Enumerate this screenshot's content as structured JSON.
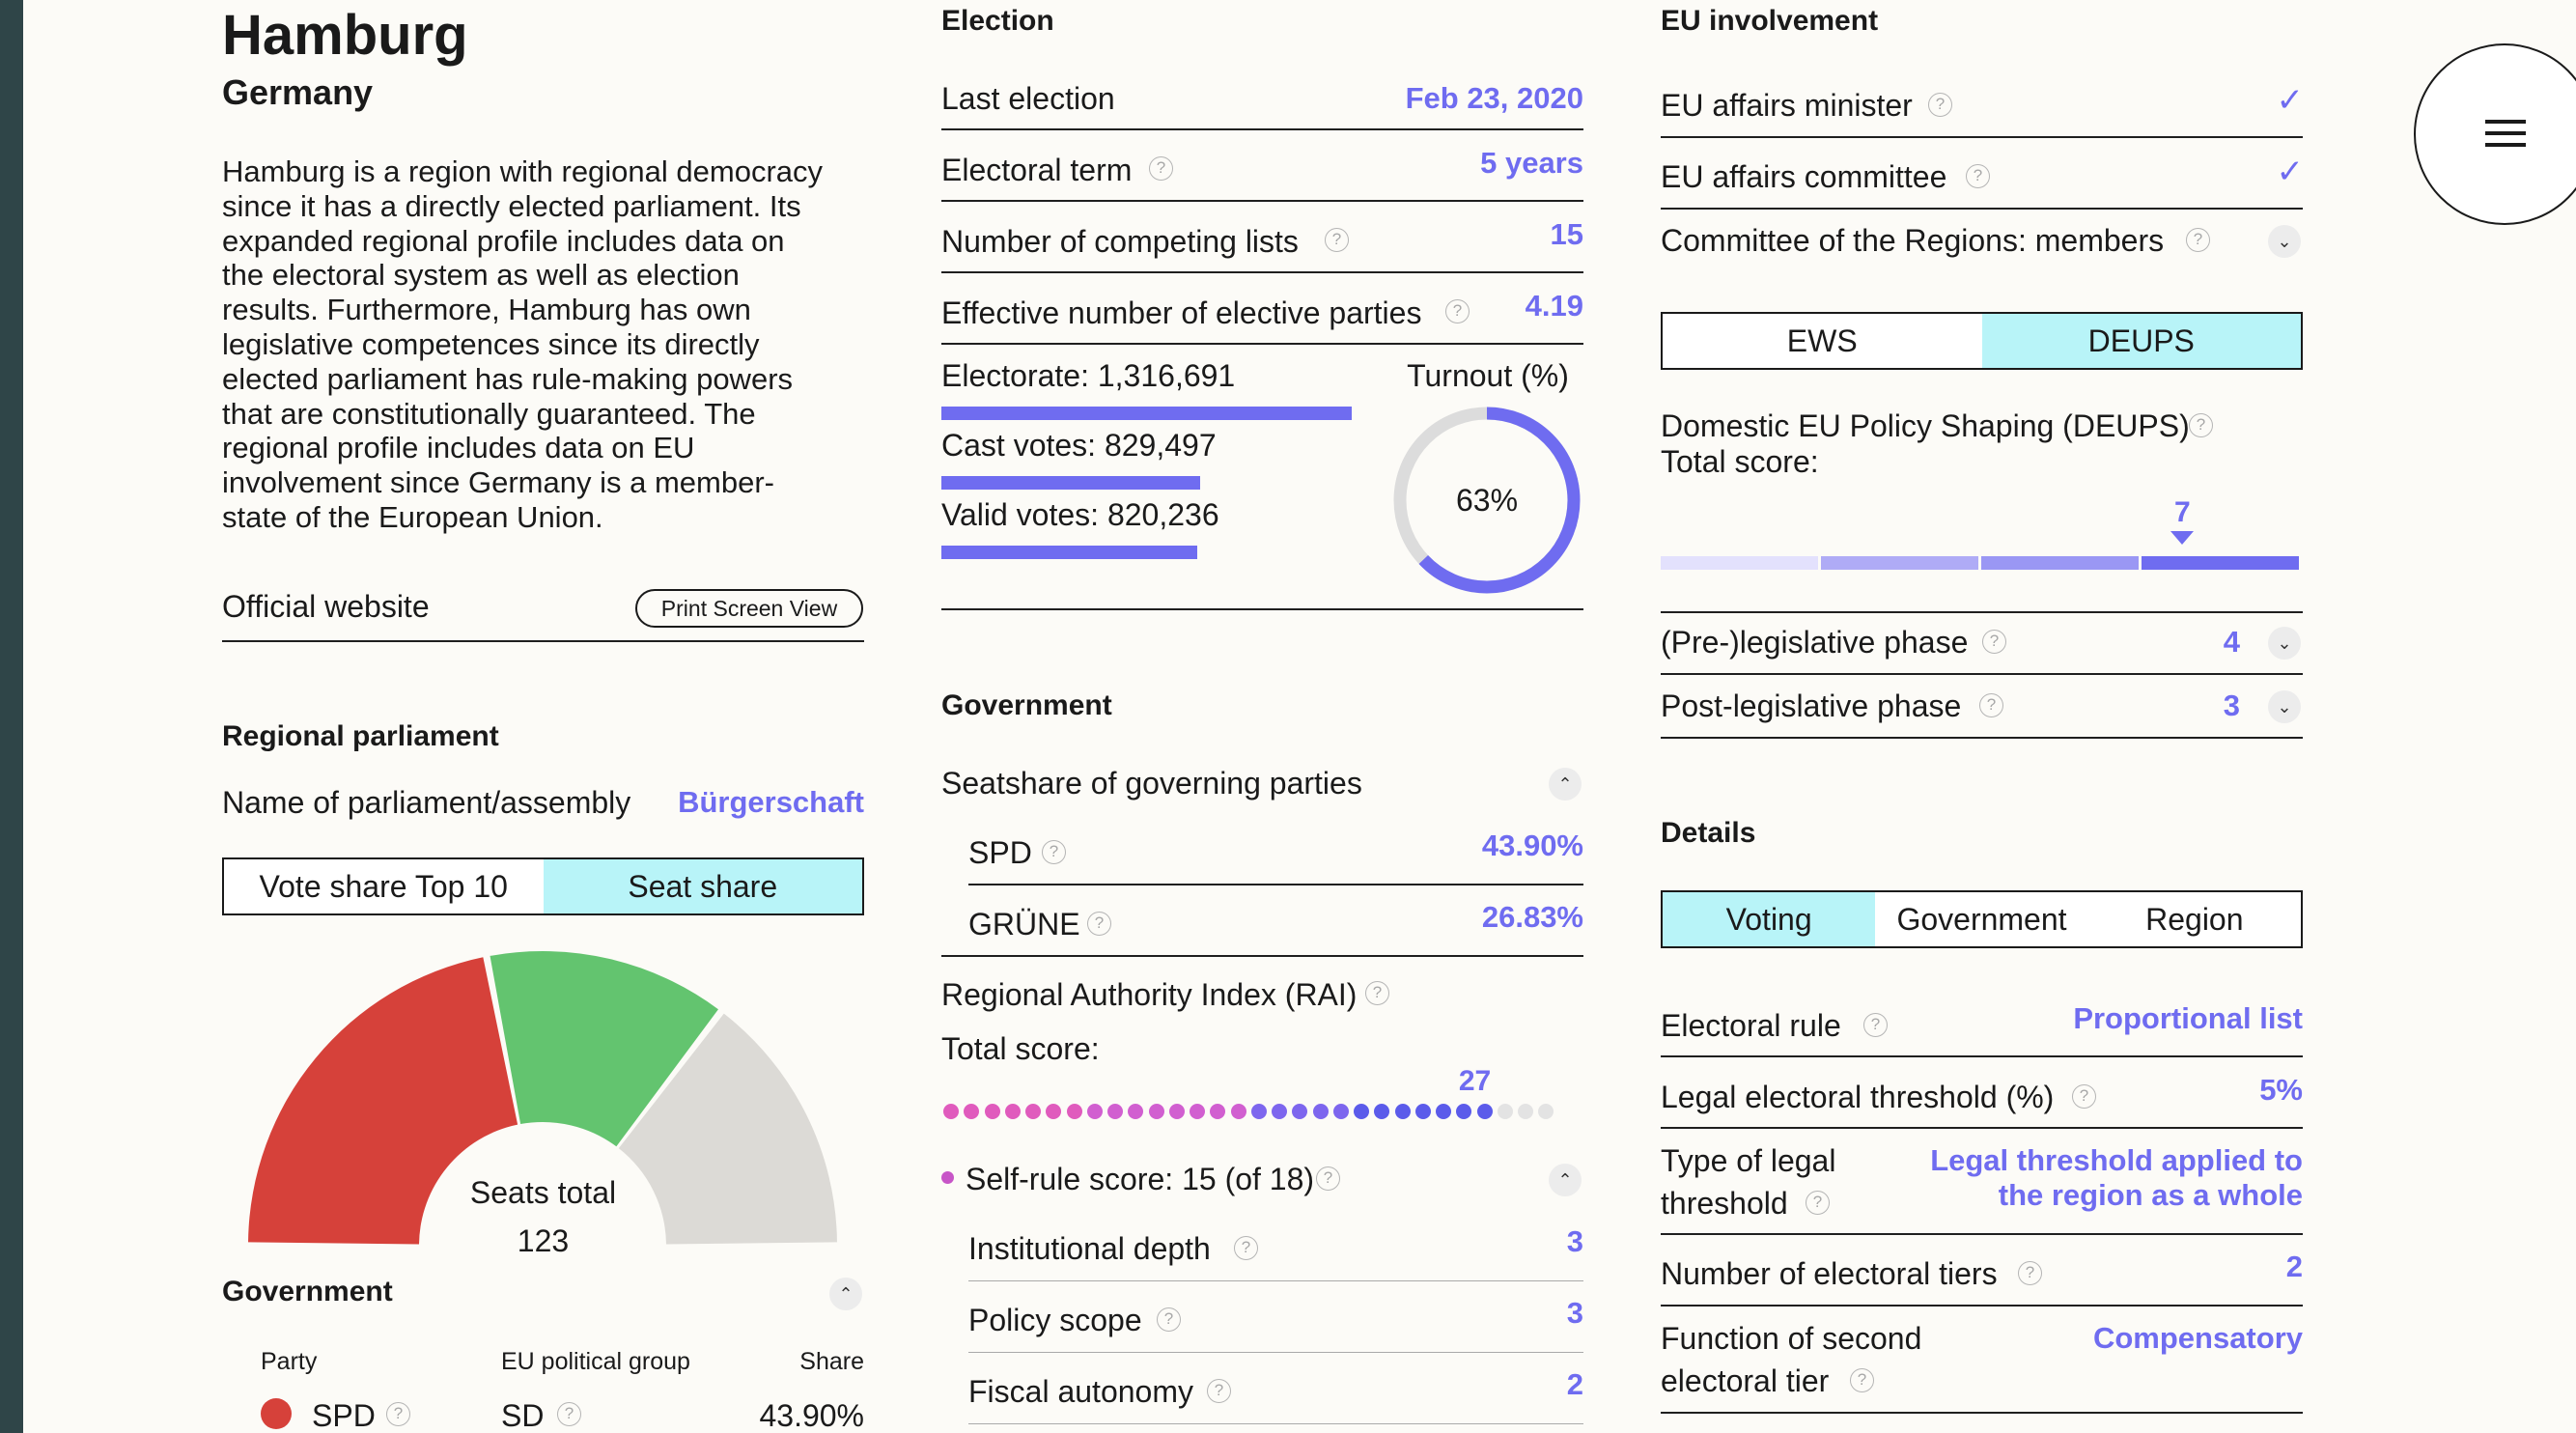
{
  "region": {
    "name": "Hamburg",
    "country": "Germany",
    "description": [
      "Hamburg is a region with regional democracy",
      "since it has a directly elected parliament. Its",
      "expanded regional profile includes data on",
      "the electoral system as well as election",
      "results. Furthermore, Hamburg has own",
      "legislative competences since its directly",
      "elected parliament has rule-making powers",
      "that are constitutionally guaranteed. The",
      "regional profile includes data on EU",
      "involvement since Germany is a member-",
      "state of the European Union."
    ],
    "official_website": "Official website",
    "print_button": "Print Screen View"
  },
  "regional_parliament": {
    "heading": "Regional parliament",
    "name_label": "Name of parliament/assembly",
    "name_value": "Bürgerschaft",
    "tabs": [
      "Vote share Top 10",
      "Seat share"
    ],
    "active_tab": 1,
    "seats_label": "Seats total",
    "seats_total": "123",
    "seat_shares": [
      {
        "party": "SPD",
        "share": 43.9,
        "color": "#d6413a"
      },
      {
        "party": "GRÜNE",
        "share": 26.83,
        "color": "#63c46f"
      },
      {
        "party": "Other",
        "share": 29.27,
        "color": "#dcdad6"
      }
    ]
  },
  "government_left": {
    "heading": "Government",
    "col_party": "Party",
    "col_group": "EU political group",
    "col_share": "Share",
    "rows": [
      {
        "party": "SPD",
        "group": "SD",
        "share": "43.90%",
        "color": "#d6413a"
      }
    ]
  },
  "election": {
    "heading": "Election",
    "last_election_label": "Last election",
    "last_election": "Feb 23, 2020",
    "term_label": "Electoral term",
    "term": "5 years",
    "lists_label": "Number of competing lists",
    "lists": "15",
    "enp_label": "Effective number of elective parties",
    "enp": "4.19",
    "electorate_label": "Electorate: 1,316,691",
    "cast_label": "Cast votes: 829,497",
    "valid_label": "Valid votes: 820,236",
    "electorate": 1316691,
    "cast": 829497,
    "valid": 820236,
    "turnout_label": "Turnout (%)",
    "turnout": 63,
    "turnout_text": "63%"
  },
  "government_mid": {
    "heading": "Government",
    "seatshare_label": "Seatshare of governing parties",
    "parties": [
      {
        "name": "SPD",
        "share": "43.90%"
      },
      {
        "name": "GRÜNE",
        "share": "26.83%"
      }
    ],
    "rai_label": "Regional Authority Index (RAI)",
    "total_label": "Total score:",
    "rai_score": "27",
    "rai_value": 27,
    "rai_max": 30,
    "selfrule_label": "Self-rule score: 15 (of 18)",
    "selfrule_value": 15,
    "items": [
      {
        "label": "Institutional depth",
        "value": "3"
      },
      {
        "label": "Policy scope",
        "value": "3"
      },
      {
        "label": "Fiscal autonomy",
        "value": "2"
      }
    ]
  },
  "eu": {
    "heading": "EU involvement",
    "minister_label": "EU affairs minister",
    "committee_label": "EU affairs committee",
    "check": "✓",
    "cor_label": "Committee of the Regions: members",
    "tabs": [
      "EWS",
      "DEUPS"
    ],
    "active_tab": 1,
    "deups_label": "Domestic EU Policy Shaping (DEUPS)",
    "total_label": "Total score:",
    "deups_score": "7",
    "deups_value": 7,
    "deups_max": 8,
    "pre_label": "(Pre-)legislative phase",
    "pre_value": "4",
    "post_label": "Post-legislative phase",
    "post_value": "3"
  },
  "details": {
    "heading": "Details",
    "tabs": [
      "Voting",
      "Government",
      "Region"
    ],
    "active_tab": 0,
    "rows": [
      {
        "label": [
          "Electoral rule"
        ],
        "value": [
          "Proportional list"
        ]
      },
      {
        "label": [
          "Legal electoral threshold (%)"
        ],
        "value": [
          "5%"
        ]
      },
      {
        "label": [
          "Type of legal",
          "threshold"
        ],
        "value": [
          "Legal threshold applied to",
          "the region as a whole"
        ]
      },
      {
        "label": [
          "Number of electoral tiers"
        ],
        "value": [
          "2"
        ]
      },
      {
        "label": [
          "Function of second",
          "electoral tier"
        ],
        "value": [
          "Compensatory"
        ]
      }
    ]
  },
  "menu": {
    "icon": "hamburger-menu-icon"
  },
  "help_glyph": "?",
  "chev_up": "⌃",
  "chev_down": "⌄"
}
